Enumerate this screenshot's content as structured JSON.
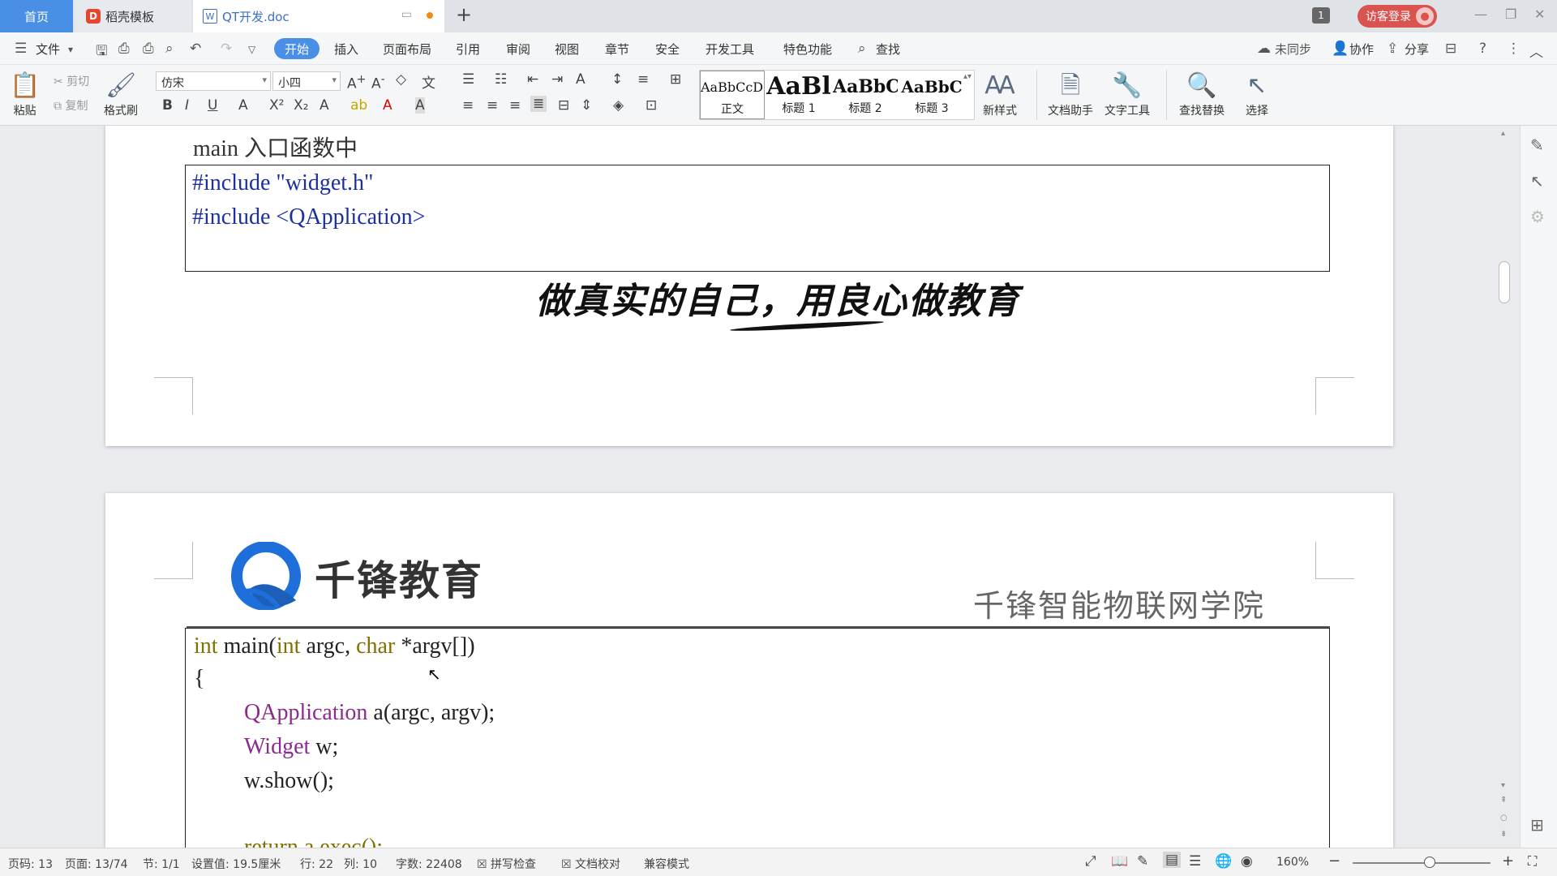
{
  "tabs": {
    "home": "首页",
    "template": "稻壳模板",
    "document": "QT开发.doc",
    "window_count": "1",
    "login": "访客登录"
  },
  "menu": {
    "file": "文件",
    "items": [
      "开始",
      "插入",
      "页面布局",
      "引用",
      "审阅",
      "视图",
      "章节",
      "安全",
      "开发工具",
      "特色功能"
    ],
    "search": "查找",
    "right": [
      "未同步",
      "协作",
      "分享"
    ]
  },
  "ribbon": {
    "paste": "粘贴",
    "cut": "剪切",
    "copy": "复制",
    "format_painter": "格式刷",
    "font_name": "仿宋",
    "font_size": "小四",
    "styles": [
      {
        "preview": "AaBbCcDd",
        "label": "正文"
      },
      {
        "preview": "AaBl",
        "label": "标题 1"
      },
      {
        "preview": "AaBbC",
        "label": "标题 2"
      },
      {
        "preview": "AaBbC",
        "label": "标题 3"
      }
    ],
    "new_style": "新样式",
    "doc_assistant": "文档助手",
    "text_tools": "文字工具",
    "find_replace": "查找替换",
    "select": "选择"
  },
  "document": {
    "page1": {
      "intro": "main 入口函数中",
      "code": [
        "#include \"widget.h\"",
        "#include <QApplication>"
      ],
      "motto": "做真实的自己，用良心做教育"
    },
    "page2": {
      "brand": "千锋教育",
      "college": "千锋智能物联网学院",
      "code": {
        "l1_int": "int",
        "l1_main": " main(",
        "l1_int2": "int",
        "l1_argc": " argc, ",
        "l1_char": "char",
        "l1_rest": " *argv[])",
        "l2": "{",
        "l3_type": "QApplication",
        "l3_rest": " a(argc, argv);",
        "l4_type": "Widget",
        "l4_rest": " w;",
        "l5": "w.show();",
        "l6": "return a.exec();"
      }
    }
  },
  "status": {
    "page_code": "页码: 13",
    "pages": "页面: 13/74",
    "section": "节: 1/1",
    "setting": "设置值: 19.5厘米",
    "row": "行: 22",
    "col": "列: 10",
    "words": "字数: 22408",
    "spell": "拼写检查",
    "proof": "文档校对",
    "compat": "兼容模式",
    "zoom": "160%"
  },
  "colors": {
    "accent": "#4a8fe6",
    "login_red": "#d9534f",
    "code_purple": "#8b2b8b",
    "code_green": "#1b7a1b",
    "code_olive": "#807000",
    "code_blue": "#1c2f9e"
  }
}
